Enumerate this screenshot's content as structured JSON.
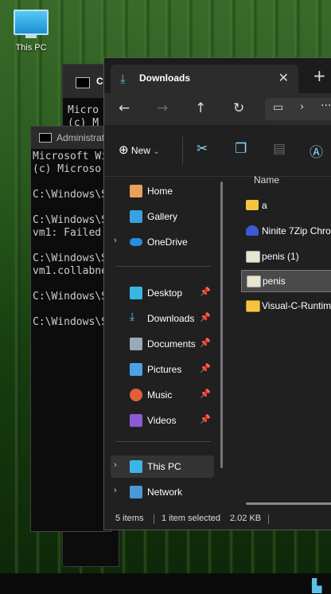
{
  "desktop": {
    "this_pc_label": "This PC"
  },
  "cmd_back": {
    "title": "C",
    "lines": "Micro\n(c) M"
  },
  "cmd_admin": {
    "title": "Administrato",
    "lines": "Microsoft Wi\n(c) Microso\n\nC:\\Windows\\S\n\nC:\\Windows\\S\nvm1: Failed\n\nC:\\Windows\\S\nvm1.collabne\n\nC:\\Windows\\S\n\nC:\\Windows\\S"
  },
  "explorer": {
    "tab_title": "Downloads",
    "new_label": "New",
    "column_name": "Name",
    "nav_items": [
      {
        "label": "Home",
        "icon": "home-icon"
      },
      {
        "label": "Gallery",
        "icon": "gallery-icon"
      },
      {
        "label": "OneDrive",
        "icon": "onedrive-icon"
      },
      {
        "label": "Desktop",
        "icon": "desktop-icon"
      },
      {
        "label": "Downloads",
        "icon": "downloads-icon"
      },
      {
        "label": "Documents",
        "icon": "documents-icon"
      },
      {
        "label": "Pictures",
        "icon": "pictures-icon"
      },
      {
        "label": "Music",
        "icon": "music-icon"
      },
      {
        "label": "Videos",
        "icon": "videos-icon"
      },
      {
        "label": "This PC",
        "icon": "this-pc-icon"
      },
      {
        "label": "Network",
        "icon": "network-icon"
      }
    ],
    "files": [
      {
        "name": "a",
        "icon": "folder-icon"
      },
      {
        "name": "Ninite 7Zip Chro",
        "icon": "installer-icon"
      },
      {
        "name": "penis (1)",
        "icon": "file-icon"
      },
      {
        "name": "penis",
        "icon": "file-icon"
      },
      {
        "name": "Visual-C-Runtim",
        "icon": "zip-folder-icon"
      }
    ],
    "status": {
      "items": "5 items",
      "selected": "1 item selected",
      "size": "2.02 KB"
    }
  },
  "colors": {
    "accent": "#5bc0eb",
    "folder": "#f5c542"
  }
}
